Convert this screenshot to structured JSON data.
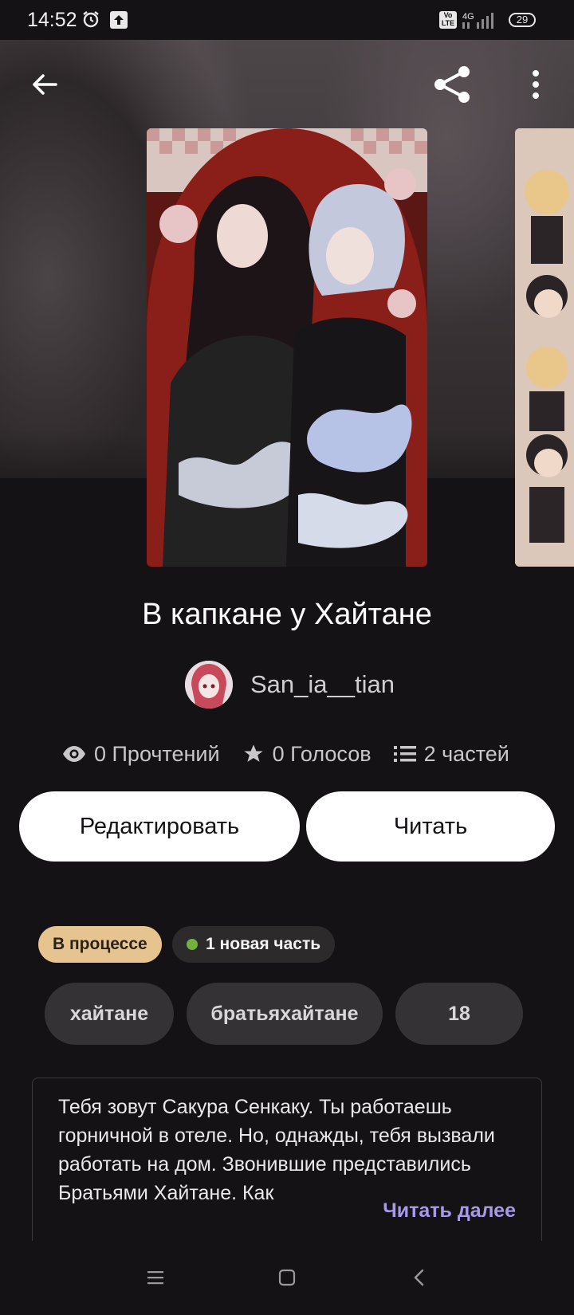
{
  "status_bar": {
    "time": "14:52",
    "network": "4G",
    "volte": "Vo LTE",
    "battery": "29",
    "icons": [
      "alarm-icon",
      "upload-icon",
      "volte-icon",
      "signal-icon",
      "battery-icon"
    ]
  },
  "toolbar": {
    "icons": [
      "back-arrow-icon",
      "share-icon",
      "more-vertical-icon"
    ]
  },
  "story": {
    "title": "В капкане у Хайтане",
    "author": "San_ia__tian",
    "stats": {
      "reads": "0 Прочтений",
      "votes": "0 Голосов",
      "parts": "2 частей"
    }
  },
  "actions": {
    "edit_label": "Редактировать",
    "read_label": "Читать"
  },
  "badges": {
    "status": "В процессе",
    "new_part": "1 новая часть",
    "new_part_dot_color": "#73b23a",
    "status_color": "#e6c48f"
  },
  "tags": [
    "хайтане",
    "братьяхайтане",
    "18"
  ],
  "description": {
    "text": "Тебя зовут Сакура Сенкаку. Ты работаешь горничной в отеле. Но, однажды, тебя вызвали работать на дом. Звонившие представились Братьями Хайтане. Как",
    "read_more": "Читать далее",
    "read_more_color": "#a89ae8"
  },
  "nav_bar": {
    "icons": [
      "menu-icon",
      "home-square-icon",
      "back-chevron-icon"
    ]
  }
}
